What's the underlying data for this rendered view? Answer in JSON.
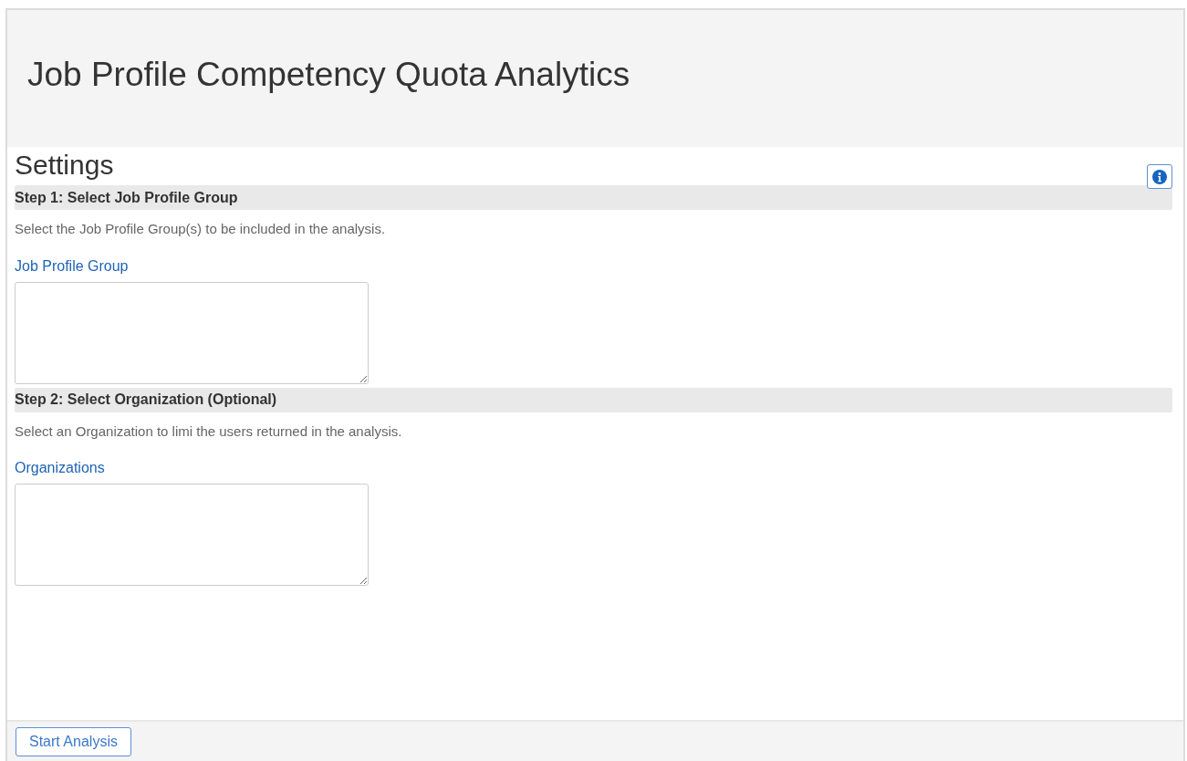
{
  "page": {
    "title": "Job Profile Competency Quota Analytics"
  },
  "settings": {
    "title": "Settings"
  },
  "steps": [
    {
      "heading": "Step 1: Select Job Profile Group",
      "description": "Select the Job Profile Group(s) to be included in the analysis.",
      "field_label": "Job Profile Group"
    },
    {
      "heading": "Step 2: Select Organization (Optional)",
      "description": "Select an Organization to limi the users returned in the analysis.",
      "field_label": "Organizations"
    }
  ],
  "footer": {
    "button": "Start Analysis"
  }
}
